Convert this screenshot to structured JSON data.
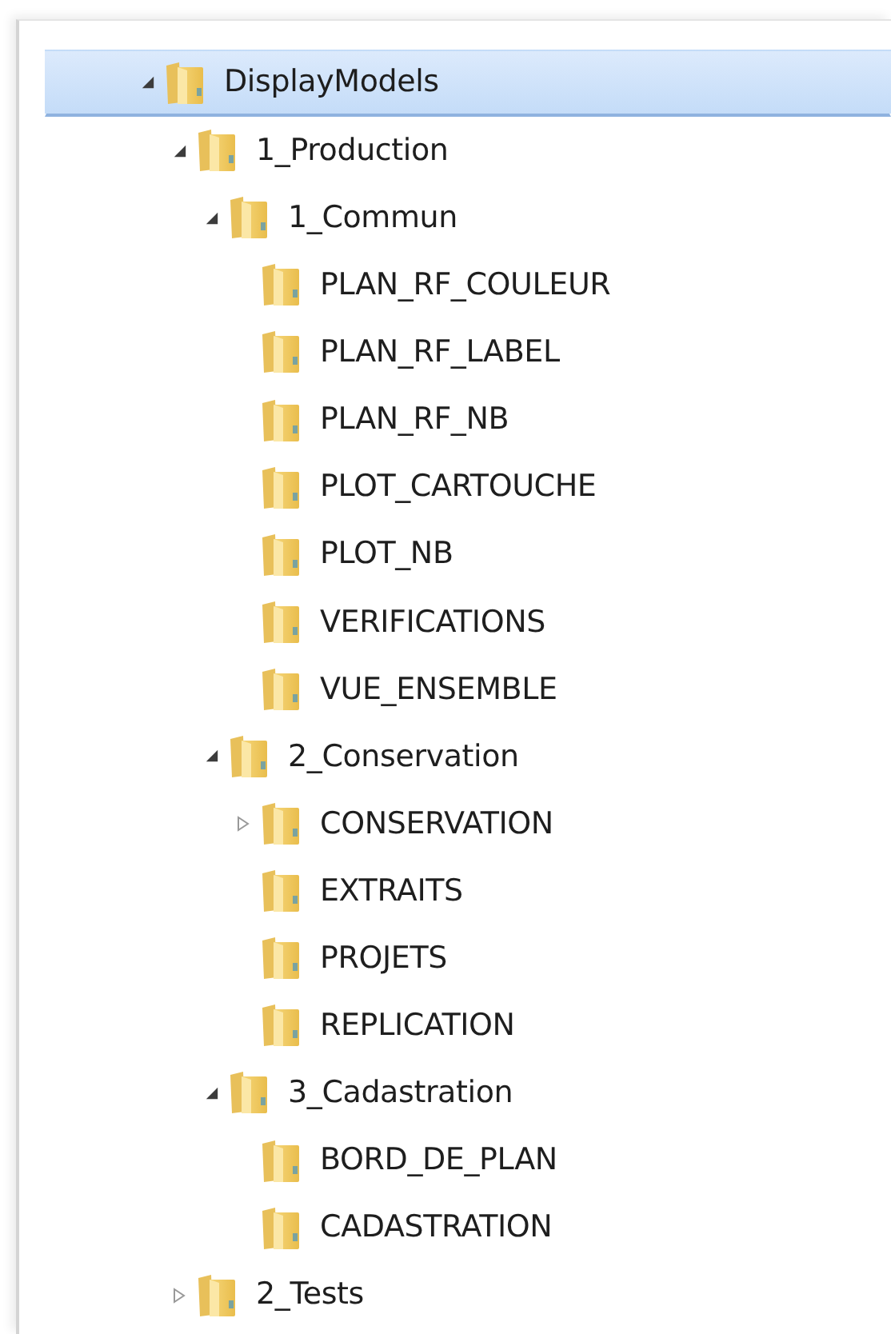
{
  "tree": [
    {
      "label": "DisplayModels",
      "selected": true,
      "expanded": true,
      "children": [
        {
          "label": "1_Production",
          "selected": false,
          "expanded": true,
          "children": [
            {
              "label": "1_Commun",
              "selected": false,
              "expanded": true,
              "children": [
                {
                  "label": "PLAN_RF_COULEUR",
                  "selected": false
                },
                {
                  "label": "PLAN_RF_LABEL",
                  "selected": false
                },
                {
                  "label": "PLAN_RF_NB",
                  "selected": false
                },
                {
                  "label": "PLOT_CARTOUCHE",
                  "selected": false
                },
                {
                  "label": "PLOT_NB",
                  "selected": false
                },
                {
                  "label": "VERIFICATIONS",
                  "selected": false
                },
                {
                  "label": "VUE_ENSEMBLE",
                  "selected": false
                }
              ]
            },
            {
              "label": "2_Conservation",
              "selected": false,
              "expanded": true,
              "children": [
                {
                  "label": "CONSERVATION",
                  "selected": false,
                  "expanded": false
                },
                {
                  "label": "EXTRAITS",
                  "selected": false
                },
                {
                  "label": "PROJETS",
                  "selected": false
                },
                {
                  "label": "REPLICATION",
                  "selected": false
                }
              ]
            },
            {
              "label": "3_Cadastration",
              "selected": false,
              "expanded": true,
              "children": [
                {
                  "label": "BORD_DE_PLAN",
                  "selected": false
                },
                {
                  "label": "CADASTRATION",
                  "selected": false
                }
              ]
            }
          ]
        },
        {
          "label": "2_Tests",
          "selected": false,
          "expanded": false
        }
      ]
    }
  ]
}
